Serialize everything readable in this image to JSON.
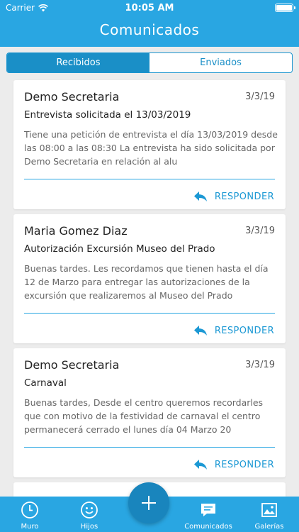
{
  "status": {
    "carrier": "Carrier",
    "time": "10:05 AM"
  },
  "header": {
    "title": "Comunicados"
  },
  "segments": {
    "received": "Recibidos",
    "sent": "Enviados"
  },
  "messages": [
    {
      "sender": "Demo Secretaria",
      "date": "3/3/19",
      "subject": "Entrevista solicitada el 13/03/2019",
      "body": "Tiene una petición de entrevista el día 13/03/2019 desde las 08:00 a las 08:30 La entrevista ha sido solicitada por Demo Secretaria en relación al alu",
      "reply": "RESPONDER"
    },
    {
      "sender": "Maria Gomez Diaz",
      "date": "3/3/19",
      "subject": "Autorización Excursión Museo del Prado",
      "body": "Buenas tardes. Les recordamos que tienen hasta el día 12 de Marzo para entregar las autorizaciones de la excursión que realizaremos al Museo del Prado",
      "reply": "RESPONDER"
    },
    {
      "sender": "Demo Secretaria",
      "date": "3/3/19",
      "subject": "Carnaval",
      "body": "Buenas tardes, Desde el centro queremos recordarles que con motivo de la festividad de carnaval el centro permanecerá cerrado el lunes día 04 Marzo 20",
      "reply": "RESPONDER"
    }
  ],
  "tabbar": {
    "muro": "Muro",
    "hijos": "Hijos",
    "comunicados": "Comunicados",
    "galerias": "Galerías"
  },
  "colors": {
    "primary": "#29a6e2",
    "accent": "#1a8fc7",
    "fab": "#1985bd"
  }
}
